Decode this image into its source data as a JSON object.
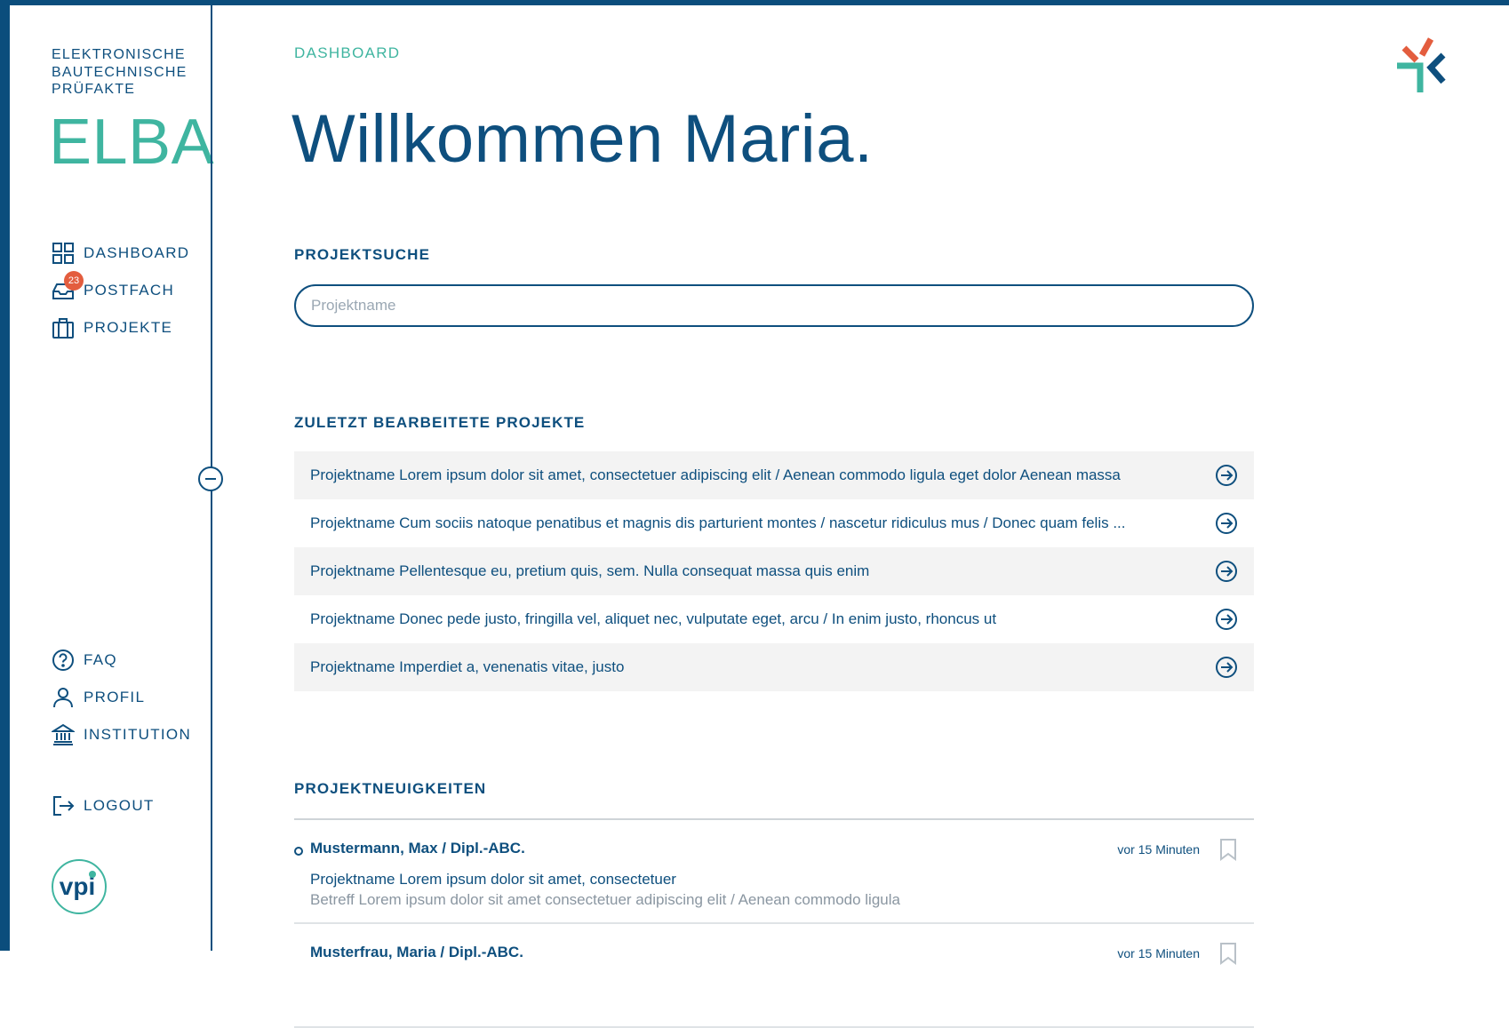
{
  "brand": {
    "subtitle_lines": [
      "ELEKTRONISCHE",
      "BAUTECHNISCHE",
      "PRÜFAKTE"
    ],
    "name": "ELBA"
  },
  "nav": {
    "primary": [
      {
        "label": "DASHBOARD",
        "icon": "grid-icon"
      },
      {
        "label": "POSTFACH",
        "icon": "inbox-icon",
        "badge": "23"
      },
      {
        "label": "PROJEKTE",
        "icon": "briefcase-icon"
      }
    ],
    "secondary": [
      {
        "label": "FAQ",
        "icon": "help-circle-icon"
      },
      {
        "label": "PROFIL",
        "icon": "user-icon"
      },
      {
        "label": "INSTITUTION",
        "icon": "institution-icon"
      }
    ],
    "logout": {
      "label": "LOGOUT",
      "icon": "logout-icon"
    }
  },
  "footer_logo": {
    "text": "vpi"
  },
  "main": {
    "breadcrumb": "DASHBOARD",
    "title": "Willkommen Maria.",
    "search": {
      "label": "PROJEKTSUCHE",
      "placeholder": "Projektname",
      "value": ""
    },
    "recent": {
      "label": "ZULETZT BEARBEITETE PROJEKTE",
      "items": [
        "Projektname Lorem ipsum dolor sit amet, consectetuer adipiscing elit / Aenean commodo ligula eget dolor Aenean massa",
        "Projektname Cum sociis natoque penatibus et magnis dis parturient montes / nascetur ridiculus mus / Donec quam felis ...",
        "Projektname Pellentesque eu, pretium quis, sem. Nulla consequat massa quis enim",
        "Projektname Donec pede justo, fringilla vel, aliquet nec, vulputate eget, arcu / In enim justo, rhoncus ut",
        "Projektname Imperdiet a, venenatis vitae, justo"
      ]
    },
    "news": {
      "label": "PROJEKTNEUIGKEITEN",
      "items": [
        {
          "author": "Mustermann, Max / Dipl.-ABC.",
          "time": "vor 15 Minuten",
          "project": "Projektname Lorem ipsum dolor sit amet, consectetuer",
          "subject": "Betreff Lorem ipsum dolor sit amet consectetuer adipiscing elit / Aenean commodo ligula"
        },
        {
          "author": "Musterfrau, Maria / Dipl.-ABC.",
          "time": "vor 15 Minuten",
          "project": "",
          "subject": ""
        }
      ]
    }
  },
  "colors": {
    "primary": "#0e4f7e",
    "accent": "#3fb5a0",
    "badge": "#e35d3e",
    "row_alt": "#f3f3f3"
  }
}
